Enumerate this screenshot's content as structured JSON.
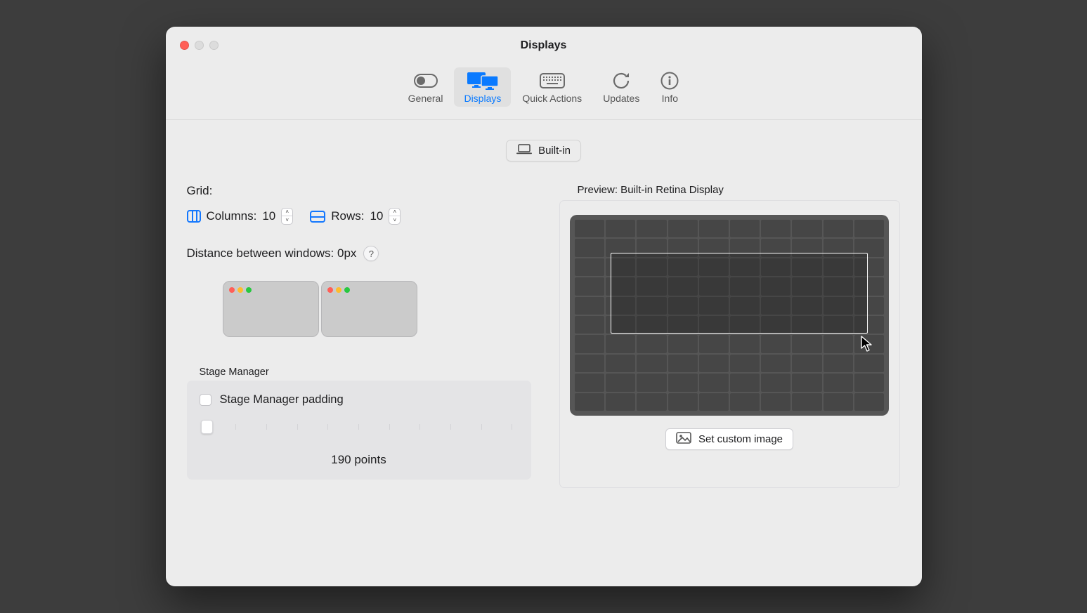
{
  "window": {
    "title": "Displays"
  },
  "toolbar": {
    "items": [
      {
        "label": "General"
      },
      {
        "label": "Displays"
      },
      {
        "label": "Quick Actions"
      },
      {
        "label": "Updates"
      },
      {
        "label": "Info"
      }
    ]
  },
  "display_selector": {
    "label": "Built-in"
  },
  "grid": {
    "section_label": "Grid:",
    "columns_label": "Columns:",
    "columns_value": "10",
    "rows_label": "Rows:",
    "rows_value": "10"
  },
  "distance_label": "Distance between windows: 0px",
  "help_btn": "?",
  "stage_manager": {
    "legend": "Stage Manager",
    "checkbox_label": "Stage Manager padding",
    "slider_readout": "190 points"
  },
  "preview": {
    "label": "Preview: Built-in Retina Display",
    "button": "Set custom image"
  }
}
